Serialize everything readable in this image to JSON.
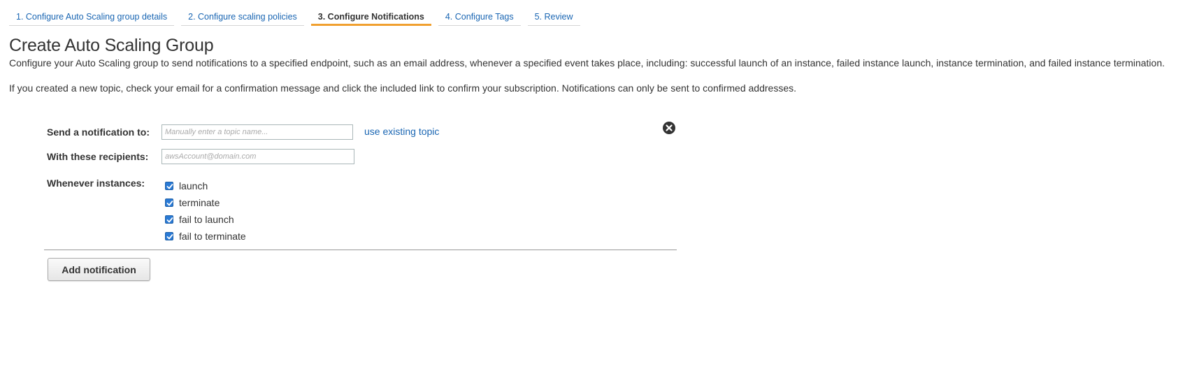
{
  "tabs": [
    {
      "label": "1. Configure Auto Scaling group details",
      "active": false
    },
    {
      "label": "2. Configure scaling policies",
      "active": false
    },
    {
      "label": "3. Configure Notifications",
      "active": true
    },
    {
      "label": "4. Configure Tags",
      "active": false
    },
    {
      "label": "5. Review",
      "active": false
    }
  ],
  "page": {
    "title": "Create Auto Scaling Group",
    "description": "Configure your Auto Scaling group to send notifications to a specified endpoint, such as an email address, whenever a specified event takes place, including: successful launch of an instance, failed instance launch, instance termination, and failed instance termination.",
    "note": "If you created a new topic, check your email for a confirmation message and click the included link to confirm your subscription. Notifications can only be sent to confirmed addresses."
  },
  "notification": {
    "send_label": "Send a notification to:",
    "topic_placeholder": "Manually enter a topic name...",
    "topic_value": "",
    "use_existing_link": "use existing topic",
    "recipients_label": "With these recipients:",
    "recipients_placeholder": "awsAccount@domain.com",
    "recipients_value": "",
    "whenever_label": "Whenever instances:",
    "events": [
      {
        "label": "launch",
        "checked": true
      },
      {
        "label": "terminate",
        "checked": true
      },
      {
        "label": "fail to launch",
        "checked": true
      },
      {
        "label": "fail to terminate",
        "checked": true
      }
    ],
    "remove_icon": "close-circle-icon"
  },
  "actions": {
    "add_notification_label": "Add notification"
  },
  "colors": {
    "link": "#1a66b3",
    "active_tab_underline": "#f0a02f",
    "checkbox": "#2a7ad5"
  }
}
